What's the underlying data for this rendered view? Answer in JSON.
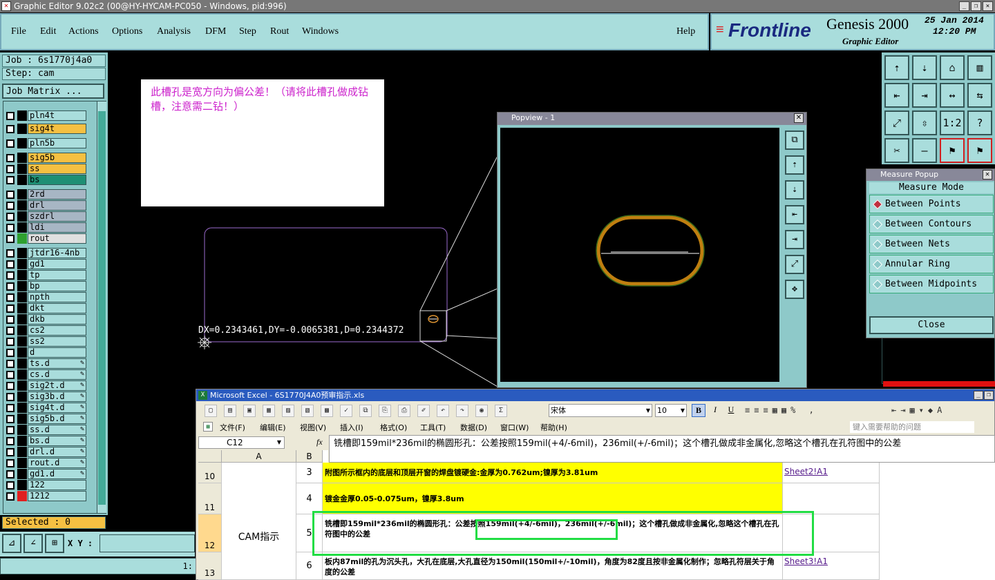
{
  "window_title": "Graphic Editor 9.02c2 (00@HY-HYCAM-PC050 - Windows, pid:996)",
  "menu": [
    "File",
    "Edit",
    "Actions",
    "Options",
    "Analysis",
    "DFM",
    "Step",
    "Rout",
    "Windows"
  ],
  "help_label": "Help",
  "brand": {
    "logo": "Frontline",
    "product": "Genesis 2000",
    "subtitle": "Graphic Editor",
    "date": "25 Jan 2014",
    "time": "12:20 PM"
  },
  "job": {
    "job_label": "Job : 6s1770j4a0",
    "step_label": "Step: cam",
    "job_matrix_button": "Job Matrix ...",
    "selected": "Selected : 0"
  },
  "layers": [
    {
      "name": "pln4t",
      "style": "teal"
    },
    {
      "name": "sig4t",
      "style": "yellow"
    },
    {
      "name": "pln5b",
      "style": "teal"
    },
    {
      "name": "sig5b",
      "style": "yellow"
    },
    {
      "name": "ss",
      "style": "yellow"
    },
    {
      "name": "bs",
      "style": "green"
    },
    {
      "name": "2rd",
      "style": "slate"
    },
    {
      "name": "drl",
      "style": "slate"
    },
    {
      "name": "szdrl",
      "style": "slate"
    },
    {
      "name": "ldi",
      "style": "slate"
    },
    {
      "name": "rout",
      "style": "white"
    },
    {
      "name": "jtdr16-4nb",
      "style": "teal"
    },
    {
      "name": "gd1",
      "style": "teal"
    },
    {
      "name": "tp",
      "style": "teal"
    },
    {
      "name": "bp",
      "style": "teal"
    },
    {
      "name": "npth",
      "style": "teal"
    },
    {
      "name": "dkt",
      "style": "teal"
    },
    {
      "name": "dkb",
      "style": "teal"
    },
    {
      "name": "cs2",
      "style": "teal"
    },
    {
      "name": "ss2",
      "style": "teal"
    },
    {
      "name": "d",
      "style": "teal"
    },
    {
      "name": "ts.d",
      "style": "teal"
    },
    {
      "name": "cs.d",
      "style": "teal"
    },
    {
      "name": "sig2t.d",
      "style": "teal"
    },
    {
      "name": "sig3b.d",
      "style": "teal"
    },
    {
      "name": "sig4t.d",
      "style": "teal"
    },
    {
      "name": "sig5b.d",
      "style": "teal"
    },
    {
      "name": "ss.d",
      "style": "teal"
    },
    {
      "name": "bs.d",
      "style": "teal"
    },
    {
      "name": "drl.d",
      "style": "teal"
    },
    {
      "name": "rout.d",
      "style": "teal"
    },
    {
      "name": "gd1.d",
      "style": "teal"
    },
    {
      "name": "122",
      "style": "teal"
    },
    {
      "name": "1212",
      "style": "teal"
    }
  ],
  "xy_label": "X Y :",
  "canvas": {
    "note": "此槽孔是宽方向为偏公差！（请将此槽孔做成钻槽，注意需二钻！）",
    "measure_text": "DX=0.2343461,DY=-0.0065381,D=0.2344372"
  },
  "popview": {
    "title": "Popview - 1"
  },
  "measure": {
    "title": "Measure Popup",
    "mode_label": "Measure Mode",
    "options": [
      "Between Points",
      "Between Contours",
      "Between Nets",
      "Annular Ring",
      "Between Midpoints"
    ],
    "close": "Close"
  },
  "excel": {
    "title": "Microsoft Excel - 6S1770J4A0预审指示.xls",
    "font": "宋体",
    "font_size": "10",
    "menu": [
      "文件(F)",
      "编辑(E)",
      "视图(V)",
      "插入(I)",
      "格式(O)",
      "工具(T)",
      "数据(D)",
      "窗口(W)",
      "帮助(H)"
    ],
    "help_search": "键入需要帮助的问题",
    "name_box": "C12",
    "fx": "fx",
    "formula": "铣槽即159mil*236mil的椭圆形孔：公差按照159mil(+4/-6mil)，236mil(+/-6mil)；这个槽孔做成非金属化,忽略这个槽孔在孔符图中的公差",
    "col_headers": [
      "A",
      "B"
    ],
    "merged_a": "CAM指示",
    "rows": [
      {
        "num": "10",
        "b": "3",
        "c": "附图所示框内的底层和顶层开窗的焊盘镀硬金:金厚为0.762um;镍厚为3.81um",
        "d": "Sheet2!A1"
      },
      {
        "num": "11",
        "b": "4",
        "c": "镀金金厚0.05-0.075um，镍厚3.8um",
        "d": ""
      },
      {
        "num": "12",
        "b": "5",
        "c": "铣槽即159mil*236mil的椭圆形孔：公差按照159mil(+4/-6mil)，236mil(+/-6mil)；这个槽孔做成非金属化,忽略这个槽孔在孔符图中的公差",
        "d": ""
      },
      {
        "num": "13",
        "b": "6",
        "c": "板内87mil的孔为沉头孔，大孔在底层,大孔直径为150mil(150mil+/-10mil)，角度为82度且按非金属化制作；忽略孔符层关于角度的公差",
        "d": "Sheet3!A1"
      }
    ]
  },
  "status_bar_text": "1:"
}
